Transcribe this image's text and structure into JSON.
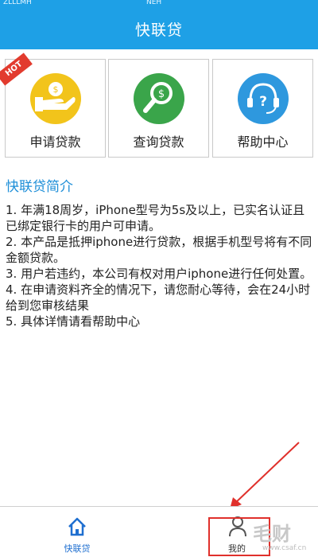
{
  "status_bar": {
    "left": "ZLLLMH",
    "center": "NEH"
  },
  "header": {
    "title": "快联贷"
  },
  "badge": {
    "hot": "HOT"
  },
  "cards": [
    {
      "label": "申请贷款",
      "icon": "money-hand-icon",
      "color": "#f2c41b"
    },
    {
      "label": "查询贷款",
      "icon": "dollar-magnifier-icon",
      "color": "#3aa54a"
    },
    {
      "label": "帮助中心",
      "icon": "headset-question-icon",
      "color": "#2e98de"
    }
  ],
  "intro": {
    "title": "快联贷简介",
    "items": [
      "1. 年满18周岁，iPhone型号为5s及以上，已实名认证且已绑定银行卡的用户可申请。",
      "2. 本产品是抵押iphone进行贷款，根据手机型号将有不同金额贷款。",
      "3. 用户若违约，本公司有权对用户iphone进行任何处置。",
      "4. 在申请资料齐全的情况下，请您耐心等待，会在24小时给到您审核结果",
      "5. 具体详情请看帮助中心"
    ]
  },
  "tabs": [
    {
      "label": "快联贷",
      "icon": "home-icon"
    },
    {
      "label": "我的",
      "icon": "user-icon"
    }
  ],
  "watermark": {
    "text": "毛财",
    "sub": "www.csaf.cn"
  },
  "colors": {
    "brand_blue": "#1ea0e6",
    "title_blue": "#1f8fd8",
    "highlight_red": "#e0302b"
  }
}
